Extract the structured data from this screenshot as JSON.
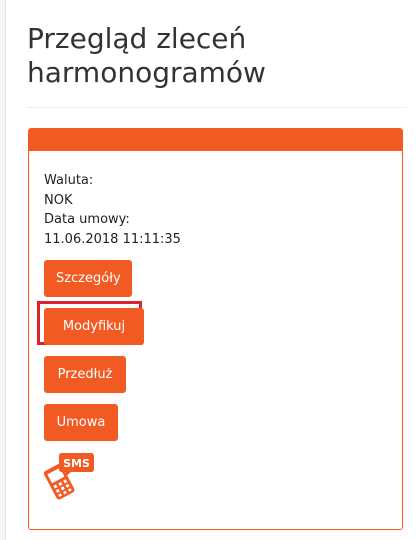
{
  "page": {
    "title": "Przegląd zleceń harmonogramów"
  },
  "order": {
    "currency_label": "Waluta:",
    "currency_value": "NOK",
    "contract_date_label": "Data umowy:",
    "contract_date_value": "11.06.2018 11:11:35"
  },
  "actions": {
    "details_label": "Szczegóły",
    "modify_label": "Modyfikuj",
    "extend_label": "Przedłuż",
    "contract_label": "Umowa"
  },
  "sms": {
    "icon": "sms-phone-icon",
    "label": "SMS"
  },
  "colors": {
    "accent": "#f15a22",
    "highlight": "#d9232e"
  }
}
